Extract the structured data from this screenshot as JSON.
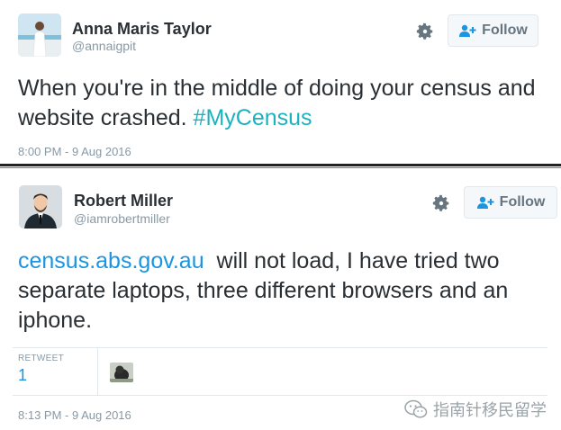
{
  "tweets": [
    {
      "name": "Anna Maris Taylor",
      "handle": "@annaigpit",
      "follow_label": "Follow",
      "text_plain": "When you're in the middle of doing your census and website crashed. ",
      "hashtag": "#MyCensus",
      "timestamp": "8:00 PM - 9 Aug 2016",
      "avatar_icon": "avatar-woman-beach"
    },
    {
      "name": "Robert Miller",
      "handle": "@iamrobertmiller",
      "follow_label": "Follow",
      "link": "census.abs.gov.au",
      "text_rest": "  will not load, I have tried two separate laptops, three different browsers and an iphone.",
      "retweet_label": "RETWEET",
      "retweet_count": "1",
      "timestamp": "8:13 PM - 9 Aug 2016",
      "avatar_icon": "avatar-man-suit"
    }
  ],
  "watermark": {
    "text": "指南针移民留学",
    "icon": "wechat-icon"
  },
  "colors": {
    "link": "#1b95e0",
    "hashtag": "#1bb2c0",
    "muted": "#8899a6",
    "text": "#292f33"
  }
}
